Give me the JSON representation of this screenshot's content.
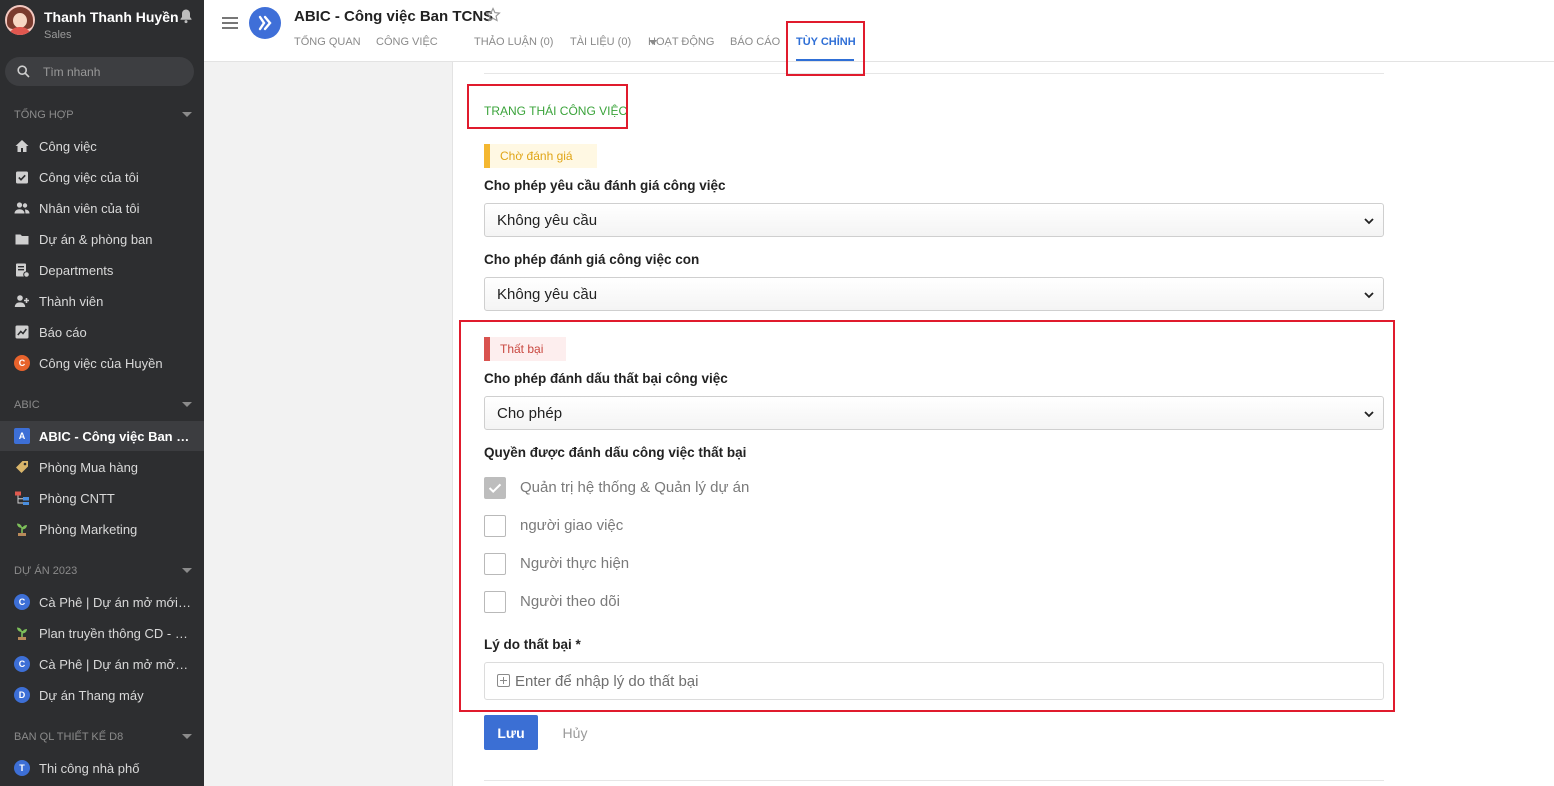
{
  "profile": {
    "name": "Thanh Thanh Huyền",
    "role": "Sales"
  },
  "search": {
    "placeholder": "Tìm nhanh"
  },
  "sidebar": {
    "sections": [
      {
        "title": "Tổng hợp"
      },
      {
        "title": "ABIC"
      },
      {
        "title": "Dự án 2023"
      },
      {
        "title": "Ban QL Thiết kế D8"
      }
    ],
    "general": [
      {
        "label": "Công việc",
        "icon": "home-icon"
      },
      {
        "label": "Công việc của tôi",
        "icon": "task-check-icon"
      },
      {
        "label": "Nhân viên của tôi",
        "icon": "people-icon"
      },
      {
        "label": "Dự án & phòng ban",
        "icon": "folder-icon"
      },
      {
        "label": "Departments",
        "icon": "department-icon"
      },
      {
        "label": "Thành viên",
        "icon": "add-member-icon"
      },
      {
        "label": "Báo cáo",
        "icon": "chart-icon"
      },
      {
        "label": "Công việc của Huyền",
        "icon": "badge-c-orange",
        "badge": "C",
        "badge_color": "#e8632c"
      }
    ],
    "abic": [
      {
        "label": "ABIC - Công việc Ban TCNS",
        "badge": "A",
        "badge_color": "#3d6fd6"
      },
      {
        "label": "Phòng Mua hàng",
        "icon": "tag-icon"
      },
      {
        "label": "Phòng CNTT",
        "icon": "org-chart-icon"
      },
      {
        "label": "Phòng Marketing",
        "icon": "plant-icon"
      }
    ],
    "projects2023": [
      {
        "label": "Cà Phê | Dự án mở mới cửa hàng",
        "badge": "C",
        "badge_color": "#3d6fd6"
      },
      {
        "label": "Plan truyền thông CD - Marketing",
        "icon": "plant-icon"
      },
      {
        "label": "Cà Phê | Dự án mở mở Vincom",
        "badge": "C",
        "badge_color": "#3d6fd6"
      },
      {
        "label": "Dự án Thang máy",
        "badge": "D",
        "badge_color": "#3d6fd6"
      }
    ],
    "d8": [
      {
        "label": "Thi công nhà phố",
        "badge": "T",
        "badge_color": "#3d6fd6"
      }
    ]
  },
  "header": {
    "title": "ABIC - Công việc Ban TCNS",
    "tabs": [
      {
        "label": "TỔNG QUAN"
      },
      {
        "label": "CÔNG VIỆC"
      },
      {
        "label": "THẢO LUẬN (0)"
      },
      {
        "label": "TÀI LIỆU (0)"
      },
      {
        "label": "HOẠT ĐỘNG"
      },
      {
        "label": "BÁO CÁO"
      },
      {
        "label": "TÙY CHỈNH"
      }
    ]
  },
  "main": {
    "section_title": "TRẠNG THÁI CÔNG VIỆC",
    "pending": {
      "tag": "Chờ đánh giá",
      "field1_label": "Cho phép yêu cầu đánh giá công việc",
      "field1_value": "Không yêu cầu",
      "field2_label": "Cho phép đánh giá công việc con",
      "field2_value": "Không yêu cầu"
    },
    "failed": {
      "tag": "Thất bại",
      "field1_label": "Cho phép đánh dấu thất bại công việc",
      "field1_value": "Cho phép",
      "perm_label": "Quyền được đánh dấu công việc thất bại",
      "permissions": [
        {
          "label": "Quản trị hệ thống & Quản lý dự án",
          "checked": true
        },
        {
          "label": "người giao việc",
          "checked": false
        },
        {
          "label": "Người thực hiện",
          "checked": false
        },
        {
          "label": "Người theo dõi",
          "checked": false
        }
      ],
      "reason_label": "Lý do thất bại *",
      "reason_placeholder": "Enter để nhập lý do thất bại"
    },
    "save_label": "Lưu",
    "cancel_label": "Hủy"
  },
  "colors": {
    "accent": "#3b6fd4",
    "sidebar_bg": "#2d2e30",
    "annotation": "#e01b2d",
    "section_green": "#3aa33a"
  }
}
